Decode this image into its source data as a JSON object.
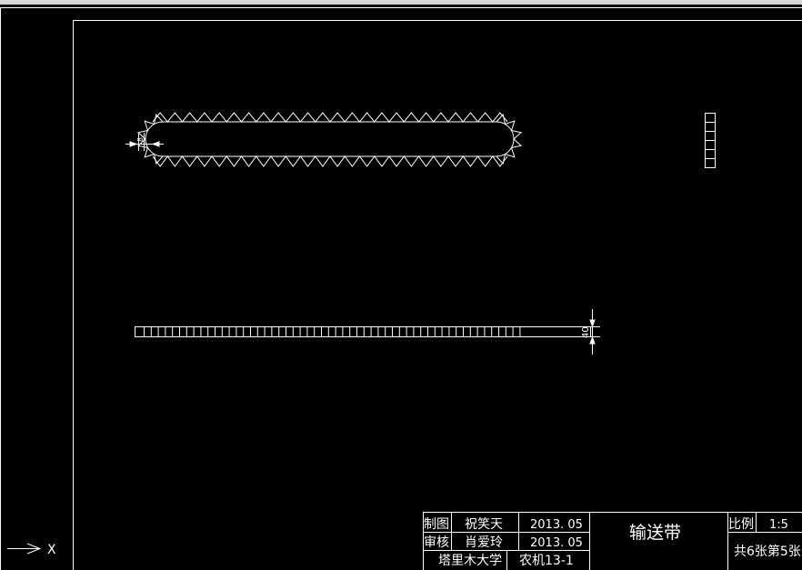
{
  "title_block": {
    "drawn_by_label": "制图",
    "drawn_by_name": "祝笑天",
    "drawn_by_date": "2013. 05",
    "checked_by_label": "审核",
    "checked_by_name": "肖爱玲",
    "checked_by_date": "2013. 05",
    "institution": "塔里木大学",
    "class_name": "农机13-1",
    "drawing_title": "输送带",
    "scale_label": "比例",
    "scale_value": "1:5",
    "sheet_info": "共6张第5张"
  },
  "dimensions": {
    "belt_thickness": "40",
    "pulley_height": "8"
  },
  "ucs": {
    "x_axis_label": "X"
  },
  "colors": {
    "background": "#000000",
    "lines": "#ffffff",
    "topbar": "#d6d6d6"
  }
}
